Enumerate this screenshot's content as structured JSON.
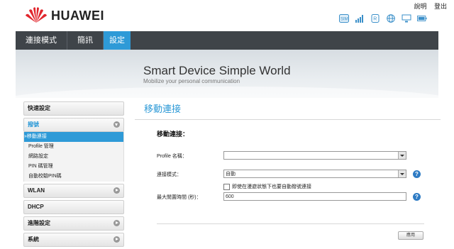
{
  "brand": {
    "name": "HUAWEI"
  },
  "header": {
    "links": [
      "說明",
      "登出"
    ]
  },
  "status_icons": [
    "sim-icon",
    "signal-icon",
    "roaming-icon",
    "internet-icon",
    "pc-icon",
    "battery-icon"
  ],
  "nav": {
    "tabs": [
      "連接模式",
      "簡訊",
      "設定"
    ],
    "active": "設定"
  },
  "banner": {
    "title": "Smart Device  Simple World",
    "subtitle": "Mobilize your personal communication"
  },
  "sidebar": {
    "quick": "快速設定",
    "dialup": "撥號",
    "dialup_items": [
      "»移動連接",
      "Profile 管理",
      "網路設定",
      "PIN 碼管理",
      "自動校驗PIN碼"
    ],
    "wlan": "WLAN",
    "dhcp": "DHCP",
    "advanced": "進階設定",
    "system": "系統"
  },
  "main": {
    "title": "移動連接",
    "section": "移動連接：",
    "profile_label": "Profile 名稱：",
    "profile_value": "",
    "mode_label": "連接模式：",
    "mode_value": "自動",
    "roam_checkbox": "即使在漫遊狀態下也要自動撥號連接",
    "idle_label": "最大閒置時間 (秒)：",
    "idle_value": "600",
    "help_glyph": "?",
    "apply_label": "應用"
  },
  "colors": {
    "accent": "#2e9ad7",
    "nav_bg": "#3f4449",
    "logo_red": "#e1262d"
  }
}
